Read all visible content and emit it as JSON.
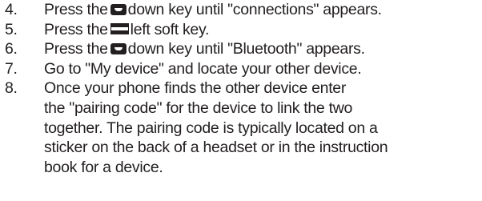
{
  "steps": [
    {
      "number": "4.",
      "before": "Press the",
      "key_icon": "down-key-icon",
      "after": "down key until \"connections\" appears."
    },
    {
      "number": "5.",
      "before": "Press the",
      "key_icon": "left-soft-key-icon",
      "after": "left soft key."
    },
    {
      "number": "6.",
      "before": "Press the",
      "key_icon": "down-key-icon",
      "after": "down key until \"Bluetooth\" appears."
    },
    {
      "number": "7.",
      "text": "Go to \"My device\" and locate your other device."
    },
    {
      "number": "8.",
      "lines": [
        "Once your phone finds the other device enter",
        "the \"pairing code\" for the device to link the two",
        "together. The pairing code is typically located on a",
        "sticker on the back of a headset or in the instruction",
        "book for a device."
      ]
    }
  ]
}
